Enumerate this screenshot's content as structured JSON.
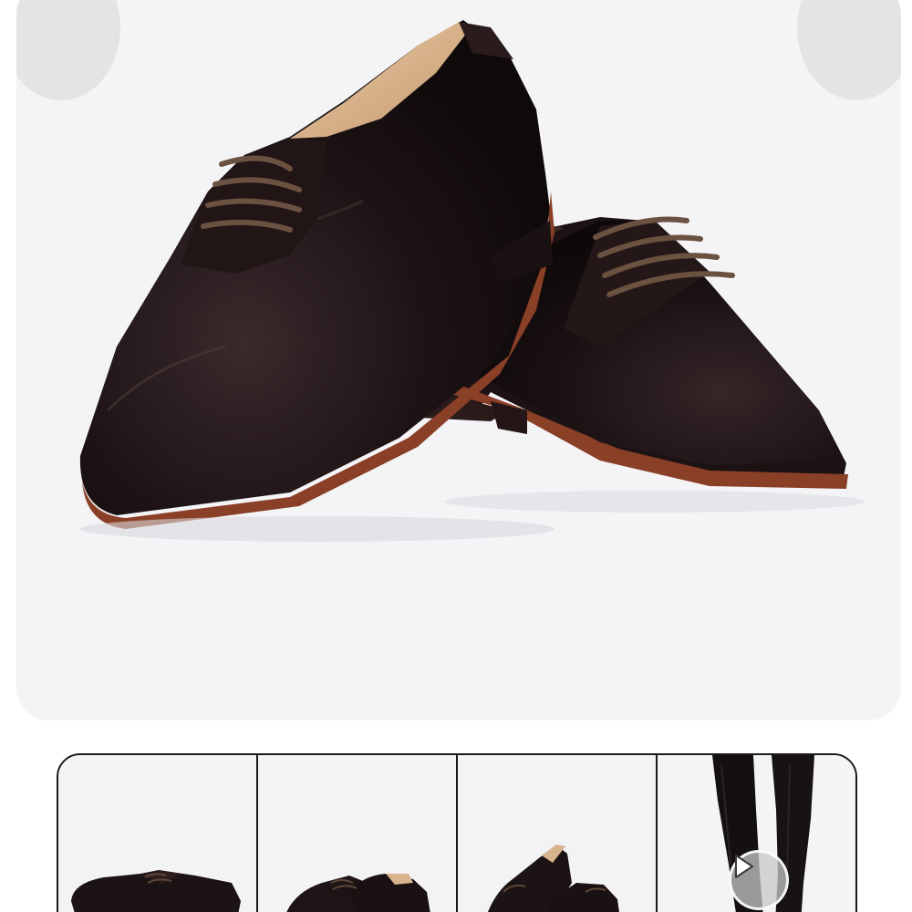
{
  "gallery": {
    "main_image": {
      "icon": "leather-oxford-shoes-photo",
      "colors": {
        "background": "#f4f4f7",
        "leather": "#1b1214",
        "sole": "#8a3f27",
        "laces": "#5a4434"
      }
    },
    "prev_icon": "chevron-left-icon",
    "next_icon": "chevron-right-icon",
    "thumbnails": [
      {
        "icon": "shoe-side-view-thumbnail",
        "selected": true
      },
      {
        "icon": "shoe-pair-front-thumbnail",
        "selected": false
      },
      {
        "icon": "shoe-pair-angle-thumbnail",
        "selected": false
      },
      {
        "icon": "video-worn-on-feet-thumbnail",
        "selected": false,
        "has_video": true
      }
    ],
    "play_icon": "play-icon"
  }
}
